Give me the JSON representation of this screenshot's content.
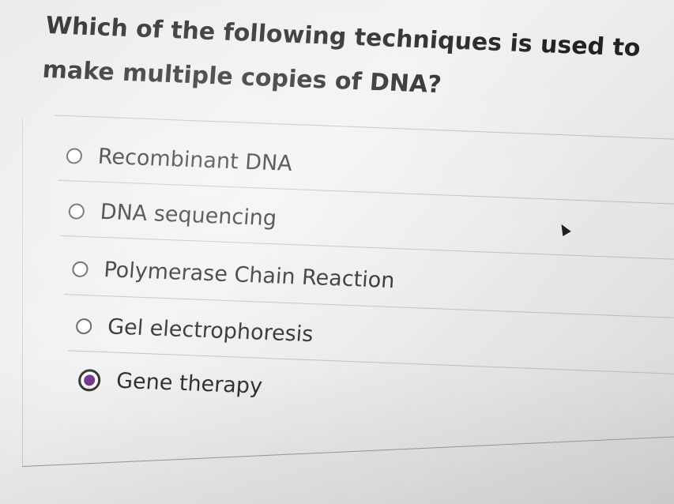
{
  "question": {
    "text": "Which of the following techniques is used to make multiple copies of DNA?"
  },
  "options": [
    {
      "label": "Recombinant DNA",
      "selected": false
    },
    {
      "label": "DNA sequencing",
      "selected": false
    },
    {
      "label": "Polymerase Chain Reaction",
      "selected": false
    },
    {
      "label": "Gel electrophoresis",
      "selected": false
    },
    {
      "label": "Gene therapy",
      "selected": true
    }
  ],
  "colors": {
    "selected_radio": "#6e2a8c",
    "text": "#222222",
    "divider": "#bcbcbc"
  },
  "icons": {
    "cursor": "mouse-pointer-icon"
  }
}
